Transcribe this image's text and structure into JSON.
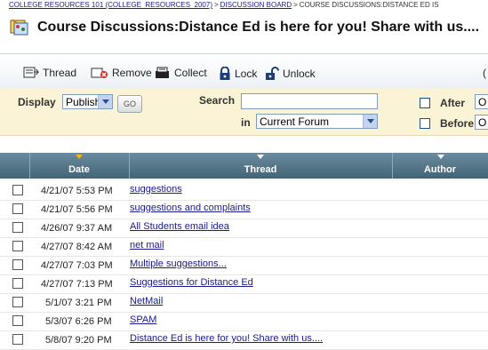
{
  "breadcrumb": {
    "course": "COLLEGE RESOURCES 101 (COLLEGE_RESOURCES_2007)",
    "sep": ">",
    "board": "DISCUSSION BOARD",
    "current": "COURSE DISCUSSIONS:DISTANCE ED IS"
  },
  "page": {
    "title": "Course Discussions:Distance Ed is here for you! Share with us...."
  },
  "toolbar": {
    "thread": "Thread",
    "remove": "Remove",
    "collect": "Collect",
    "lock": "Lock",
    "unlock": "Unlock",
    "trailing": "("
  },
  "filter": {
    "display_label": "Display",
    "display_value": "Published",
    "go_label": "GO",
    "search_label": "Search",
    "search_value": "",
    "in_label": "in",
    "in_value": "Current Forum",
    "after_label": "After",
    "after_value": "O",
    "before_label": "Before",
    "before_value": "O"
  },
  "grid": {
    "columns": [
      "Date",
      "Thread",
      "Author"
    ],
    "rows": [
      {
        "date": "4/21/07 5:53 PM",
        "thread": "suggestions"
      },
      {
        "date": "4/21/07 5:56 PM",
        "thread": "suggestions and complaints"
      },
      {
        "date": "4/26/07 9:37 AM",
        "thread": "All Students email idea"
      },
      {
        "date": "4/27/07 8:42 AM",
        "thread": "net mail"
      },
      {
        "date": "4/27/07 7:03 PM",
        "thread": "Multiple suggestions..."
      },
      {
        "date": "4/27/07 7:13 PM",
        "thread": "Suggestions for Distance Ed"
      },
      {
        "date": "5/1/07 3:21 PM",
        "thread": "NetMail"
      },
      {
        "date": "5/3/07 6:26 PM",
        "thread": "SPAM"
      },
      {
        "date": "5/8/07 9:20 PM",
        "thread": "Distance Ed is here for you! Share with us...."
      }
    ]
  },
  "colors": {
    "header_bg": "#4f6f80",
    "filter_bg": "#fbf3d6",
    "link": "#1a1a8c"
  }
}
